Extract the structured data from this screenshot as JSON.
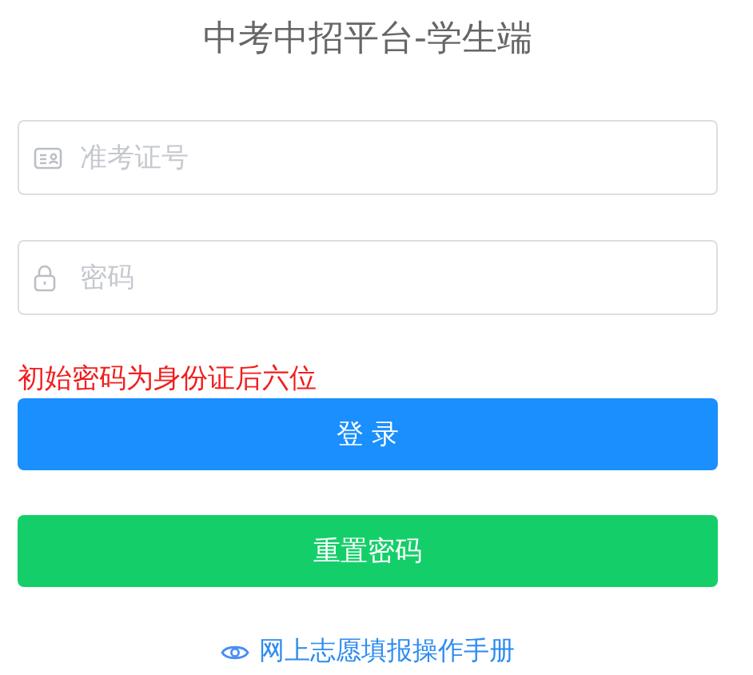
{
  "title": "中考中招平台-学生端",
  "fields": [
    {
      "kind": "id",
      "placeholder": "准考证号"
    },
    {
      "kind": "password",
      "placeholder": "密码"
    }
  ],
  "hint": "初始密码为身份证后六位",
  "buttons": [
    {
      "kind": "primary",
      "label": "登 录"
    },
    {
      "kind": "success",
      "label": "重置密码"
    }
  ],
  "manual_link": "网上志愿填报操作手册"
}
